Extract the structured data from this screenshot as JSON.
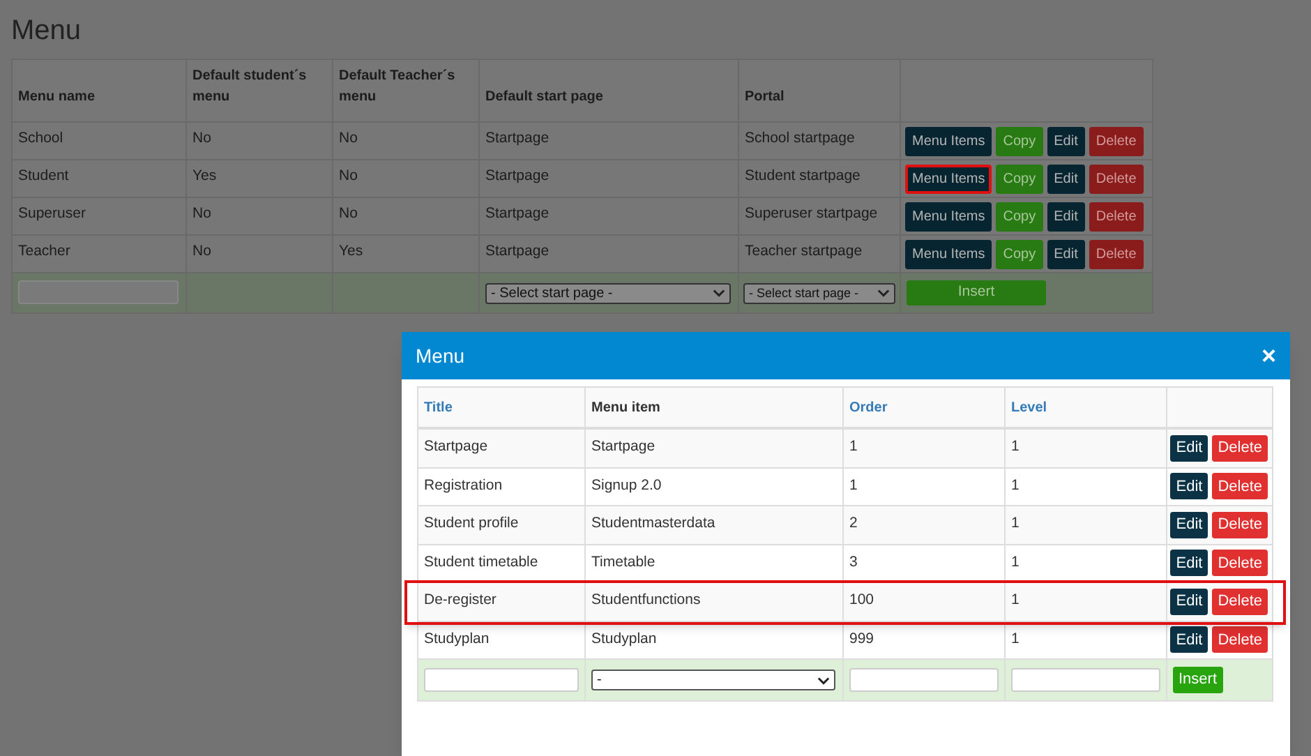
{
  "page": {
    "title": "Menu"
  },
  "menus_table": {
    "columns": [
      "Menu name",
      "Default student´s menu",
      "Default Teacher´s menu",
      "Default start page",
      "Portal"
    ],
    "rows": [
      {
        "cells": [
          "School",
          "No",
          "No",
          "Startpage",
          "School startpage"
        ],
        "actions": [
          "Menu Items",
          "Copy",
          "Edit",
          "Delete"
        ],
        "highlighted": false
      },
      {
        "cells": [
          "Student",
          "Yes",
          "No",
          "Startpage",
          "Student startpage"
        ],
        "actions": [
          "Menu Items",
          "Copy",
          "Edit",
          "Delete"
        ],
        "highlighted": true
      },
      {
        "cells": [
          "Superuser",
          "No",
          "No",
          "Startpage",
          "Superuser startpage"
        ],
        "actions": [
          "Menu Items",
          "Copy",
          "Edit",
          "Delete"
        ],
        "highlighted": false
      },
      {
        "cells": [
          "Teacher",
          "No",
          "Yes",
          "Startpage",
          "Teacher startpage"
        ],
        "actions": [
          "Menu Items",
          "Copy",
          "Edit",
          "Delete"
        ],
        "highlighted": false
      }
    ],
    "insert_row": {
      "start_page_select": "- Select start page -",
      "portal_select": "- Select start page -",
      "button": "Insert"
    }
  },
  "dialog": {
    "title": "Menu",
    "close": "×",
    "columns": [
      {
        "label": "Title",
        "sortable": true
      },
      {
        "label": "Menu item",
        "sortable": false
      },
      {
        "label": "Order",
        "sortable": true
      },
      {
        "label": "Level",
        "sortable": true
      }
    ],
    "rows": [
      {
        "cells": [
          "Startpage",
          "Startpage",
          "1",
          "1"
        ],
        "actions": [
          "Edit",
          "Delete"
        ],
        "highlighted": false
      },
      {
        "cells": [
          "Registration",
          "Signup 2.0",
          "1",
          "1"
        ],
        "actions": [
          "Edit",
          "Delete"
        ],
        "highlighted": false
      },
      {
        "cells": [
          "Student profile",
          "Studentmasterdata",
          "2",
          "1"
        ],
        "actions": [
          "Edit",
          "Delete"
        ],
        "highlighted": false
      },
      {
        "cells": [
          "Student timetable",
          "Timetable",
          "3",
          "1"
        ],
        "actions": [
          "Edit",
          "Delete"
        ],
        "highlighted": false
      },
      {
        "cells": [
          "De-register",
          "Studentfunctions",
          "100",
          "1"
        ],
        "actions": [
          "Edit",
          "Delete"
        ],
        "highlighted": true
      },
      {
        "cells": [
          "Studyplan",
          "Studyplan",
          "999",
          "1"
        ],
        "actions": [
          "Edit",
          "Delete"
        ],
        "highlighted": false
      }
    ],
    "insert_row": {
      "menu_item_select": "-",
      "button": "Insert"
    }
  }
}
